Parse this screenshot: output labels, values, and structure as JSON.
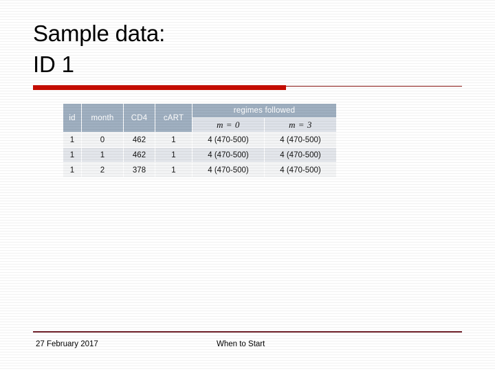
{
  "slide": {
    "title_lines": [
      "Sample data:",
      "ID 1"
    ],
    "accent_color": "#c60c00",
    "rule_color": "#8b1a17",
    "footer_rule_color": "#6e1f28"
  },
  "table": {
    "header_bg": "#9fafc0",
    "subheader_bg": "#dde1e8",
    "row_bg_light": "#f3f4f5",
    "row_bg_dark": "#e3e6eb",
    "headers": {
      "id": "id",
      "month": "month",
      "cd4": "CD4",
      "cart": "cART",
      "regimes": "regimes followed"
    },
    "subheaders": {
      "m0": "m = 0",
      "m3": "m = 3"
    },
    "rows": [
      {
        "id": "1",
        "month": "0",
        "cd4": "462",
        "cart": "1",
        "m0": "4 (470-500)",
        "m3": "4 (470-500)"
      },
      {
        "id": "1",
        "month": "1",
        "cd4": "462",
        "cart": "1",
        "m0": "4 (470-500)",
        "m3": "4 (470-500)"
      },
      {
        "id": "1",
        "month": "2",
        "cd4": "378",
        "cart": "1",
        "m0": "4 (470-500)",
        "m3": "4 (470-500)"
      }
    ]
  },
  "footer": {
    "date": "27 February 2017",
    "section": "When to Start"
  }
}
